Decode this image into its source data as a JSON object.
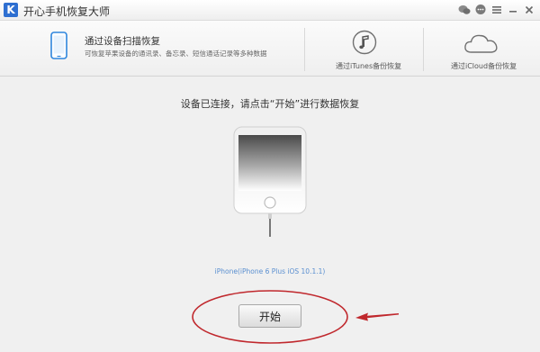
{
  "window": {
    "logo_letter": "K",
    "title": "开心手机恢复大师",
    "controls": [
      "wechat-icon",
      "chat-icon",
      "menu-icon",
      "minimize-icon",
      "close-icon"
    ]
  },
  "tabs": {
    "scan": {
      "title": "通过设备扫描恢复",
      "description": "可恢复苹果设备的通讯录、备忘录、短信通话记录等多种数据"
    },
    "itunes": {
      "label": "通过iTunes备份恢复"
    },
    "icloud": {
      "label": "通过iCloud备份恢复"
    }
  },
  "main": {
    "prompt": "设备已连接，请点击“开始”进行数据恢复",
    "device_info": "iPhone(iPhone 6 Plus iOS 10.1.1)",
    "start_label": "开始"
  },
  "colors": {
    "accent": "#2e6fd1",
    "device_text": "#5a8fd0",
    "annotation": "#c0282d"
  }
}
